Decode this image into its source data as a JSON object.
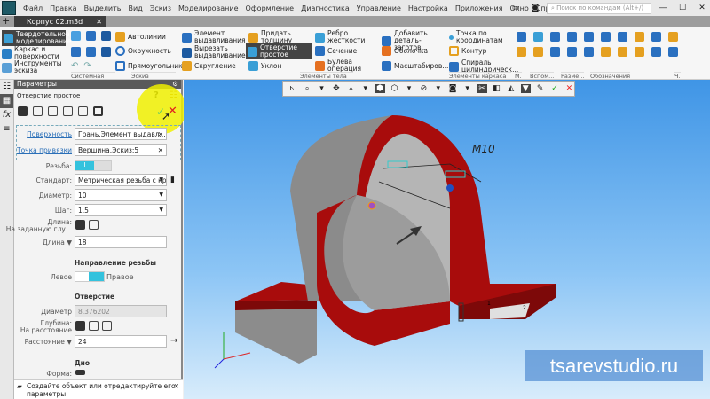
{
  "menu": [
    "Файл",
    "Правка",
    "Выделить",
    "Вид",
    "Эскиз",
    "Моделирование",
    "Оформление",
    "Диагностика",
    "Управление",
    "Настройка",
    "Приложения",
    "Окно",
    "Справка"
  ],
  "search_placeholder": "Поиск по командам (Alt+/)",
  "document_tab": "Корпус 02.m3d",
  "ribbon": {
    "modes": [
      "Твердотельное моделирование",
      "Каркас и поверхности",
      "Инструменты эскиза"
    ],
    "sketch": [
      "Автолинии",
      "Окружность",
      "Прямоугольник"
    ],
    "body": [
      "Элемент выдавливания",
      "Вырезать выдавливанием",
      "Скругление",
      "Придать толщину",
      "Отверстие простое",
      "Уклон",
      "Ребро жесткости",
      "Сечение",
      "Булева операция",
      "Добавить деталь-заготов...",
      "Оболочка",
      "Масштабиров..."
    ],
    "frame": [
      "Точка по координатам",
      "Контур",
      "Спираль цилиндрическ..."
    ],
    "groups": [
      "Системная",
      "Эскиз",
      "Элементы тела",
      "Элементы каркаса",
      "М.",
      "Вспом...",
      "Разме...",
      "Обозначения",
      "Ч."
    ]
  },
  "panel": {
    "title": "Параметры",
    "operation": "Отверстие простое",
    "surface_label": "Поверхность",
    "surface_value": "Грань.Элемент выдавл...",
    "point_label": "Точка привязки",
    "point_value": "Вершина.Эскиз:5",
    "thread_label": "Резьба:",
    "thread_toggle": "I",
    "standard_label": "Стандарт:",
    "standard_value": "Метрическая резьба с кр",
    "diameter_label": "Диаметр:",
    "diameter_value": "10",
    "pitch_label": "Шаг:",
    "pitch_value": "1.5",
    "length_label": "Длина:",
    "length_sub": "На заданную глу...",
    "length2_label": "Длина ▼",
    "length2_value": "18",
    "direction_title": "Направление резьбы",
    "left": "Левое",
    "right": "Правое",
    "hole_title": "Отверстие",
    "hole_diam_label": "Диаметр",
    "hole_diam_value": "8.376202",
    "depth_label": "Глубина:",
    "depth_sub": "На расстояние",
    "distance_label": "Расстояние ▼",
    "distance_value": "24",
    "bottom_title": "Дно",
    "shape_label": "Форма:",
    "hint": "Создайте объект или отредактируйте его параметры"
  },
  "model": {
    "thread_label": "M10",
    "points": [
      "1",
      "2"
    ],
    "colors": {
      "body": "#9a9a9a",
      "selected": "#b00d0d"
    }
  },
  "watermark": "tsarevstudio.ru"
}
